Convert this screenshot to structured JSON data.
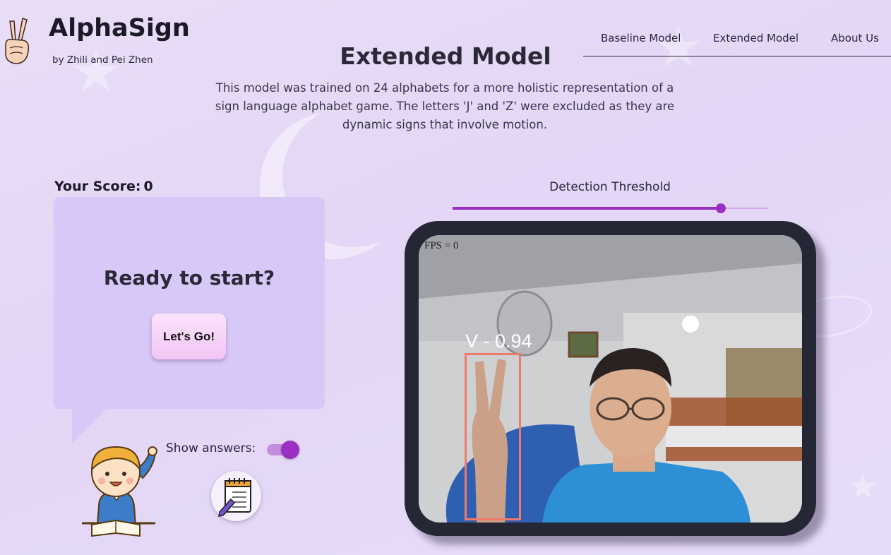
{
  "brand": {
    "title": "AlphaSign",
    "subtitle": "by Zhili and Pei Zhen",
    "logo_icon": "peace-hand-icon"
  },
  "nav": {
    "items": [
      {
        "label": "Baseline Model"
      },
      {
        "label": "Extended Model"
      },
      {
        "label": "About Us"
      }
    ]
  },
  "page": {
    "title": "Extended Model",
    "description": "This model was trained on 24 alphabets for a more holistic representation of a sign language alphabet game. The letters 'J' and 'Z' were excluded as they are dynamic signs that involve motion."
  },
  "game": {
    "score_label": "Your Score:",
    "score_value": "0",
    "prompt": "Ready to start?",
    "start_button": "Let's Go!",
    "show_answers_label": "Show answers:",
    "show_answers_on": true,
    "notes_icon": "notepad-icon"
  },
  "detection": {
    "threshold_label": "Detection Threshold",
    "threshold_value": 0.85,
    "fps_text": "FPS = 0",
    "result_label": "V - 0.94"
  },
  "colors": {
    "accent": "#9b2fc3",
    "box": "#f07a6a",
    "bubble": "#d8c8f7"
  }
}
